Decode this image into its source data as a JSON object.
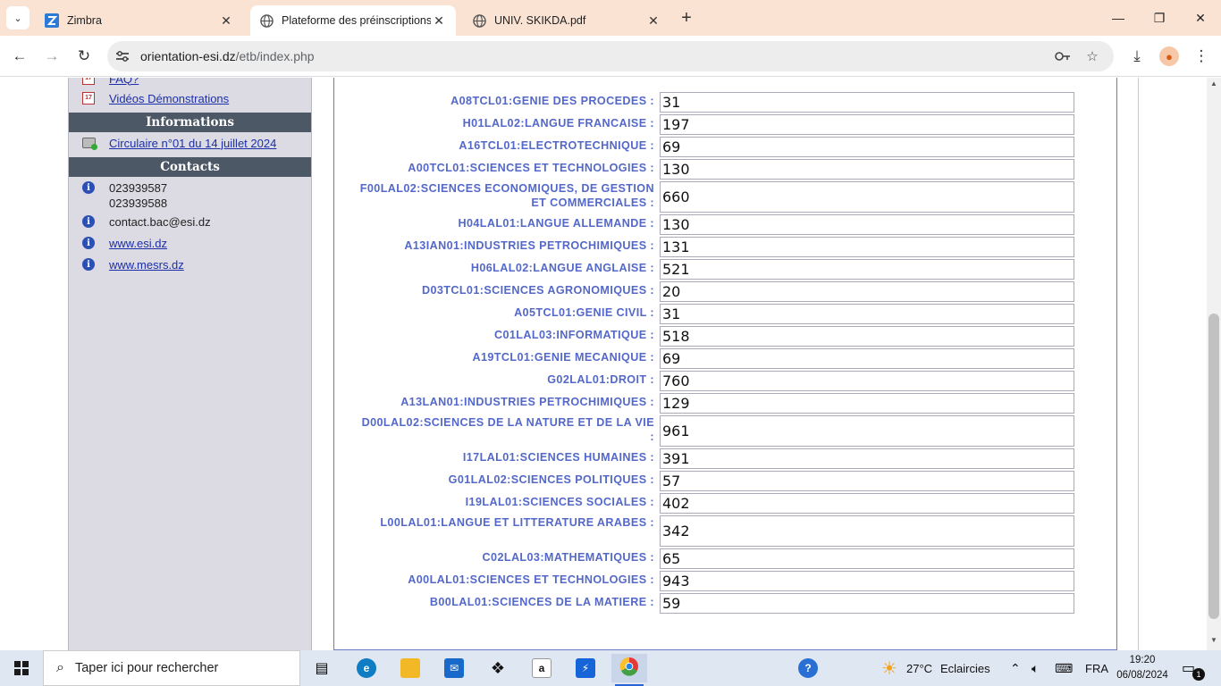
{
  "browser": {
    "tabs": [
      {
        "title": "Zimbra",
        "icon": "zimbra-icon",
        "active": false
      },
      {
        "title": "Plateforme des préinscriptions",
        "icon": "globe-icon",
        "active": true
      },
      {
        "title": "UNIV. SKIKDA.pdf",
        "icon": "globe-icon",
        "active": false
      }
    ],
    "url": {
      "host": "orientation-esi.dz",
      "path": "/etb/index.php"
    }
  },
  "sidebar": {
    "links_top": [
      {
        "label": "FAQ?"
      },
      {
        "label": "Vidéos Démonstrations"
      }
    ],
    "informations_title": "Informations",
    "informations": [
      {
        "label": "Circulaire n°01 du 14 juillet 2024"
      }
    ],
    "contacts_title": "Contacts",
    "contacts": {
      "phone1": "023939587",
      "phone2": "023939588",
      "email": "contact.bac@esi.dz",
      "site1": "www.esi.dz",
      "site2": "www.mesrs.dz"
    }
  },
  "form": {
    "rows": [
      {
        "label": "A08TCL01:GENIE DES PROCEDES :",
        "value": "31"
      },
      {
        "label": "H01LAL02:LANGUE FRANCAISE :",
        "value": "197"
      },
      {
        "label": "A16TCL01:ELECTROTECHNIQUE :",
        "value": "69"
      },
      {
        "label": "A00TCL01:SCIENCES ET TECHNOLOGIES :",
        "value": "130"
      },
      {
        "label": "F00LAL02:SCIENCES ECONOMIQUES, DE GESTION ET COMMERCIALES :",
        "value": "660"
      },
      {
        "label": "H04LAL01:LANGUE ALLEMANDE :",
        "value": "130"
      },
      {
        "label": "A13IAN01:INDUSTRIES PETROCHIMIQUES :",
        "value": "131"
      },
      {
        "label": "H06LAL02:LANGUE ANGLAISE :",
        "value": "521"
      },
      {
        "label": "D03TCL01:SCIENCES AGRONOMIQUES :",
        "value": "20"
      },
      {
        "label": "A05TCL01:GENIE CIVIL :",
        "value": "31"
      },
      {
        "label": "C01LAL03:INFORMATIQUE :",
        "value": "518"
      },
      {
        "label": "A19TCL01:GENIE MECANIQUE :",
        "value": "69"
      },
      {
        "label": "G02LAL01:DROIT :",
        "value": "760"
      },
      {
        "label": "A13LAN01:INDUSTRIES PETROCHIMIQUES :",
        "value": "129"
      },
      {
        "label": "D00LAL02:SCIENCES DE LA NATURE ET DE LA VIE :",
        "value": "961"
      },
      {
        "label": "I17LAL01:SCIENCES HUMAINES :",
        "value": "391"
      },
      {
        "label": "G01LAL02:SCIENCES POLITIQUES :",
        "value": "57"
      },
      {
        "label": "I19LAL01:SCIENCES SOCIALES :",
        "value": "402"
      },
      {
        "label": "L00LAL01:LANGUE ET LITTERATURE ARABES :",
        "value": "342"
      },
      {
        "label": "C02LAL03:MATHEMATIQUES :",
        "value": "65"
      },
      {
        "label": "A00LAL01:SCIENCES ET TECHNOLOGIES :",
        "value": "943"
      },
      {
        "label": "B00LAL01:SCIENCES DE LA MATIERE :",
        "value": "59"
      }
    ]
  },
  "taskbar": {
    "search_placeholder": "Taper ici pour rechercher",
    "weather_temp": "27°C",
    "weather_text": "Eclaircies",
    "language": "FRA",
    "time": "19:20",
    "date": "06/08/2024",
    "notification_count": "1"
  },
  "colors": {
    "tabstrip_bg": "#fbe3d4",
    "label_color": "#5468c9",
    "sidebar_header_bg": "#4d5866",
    "sidebar_bg": "#dcdbe3",
    "link_color": "#1b2fa8"
  }
}
